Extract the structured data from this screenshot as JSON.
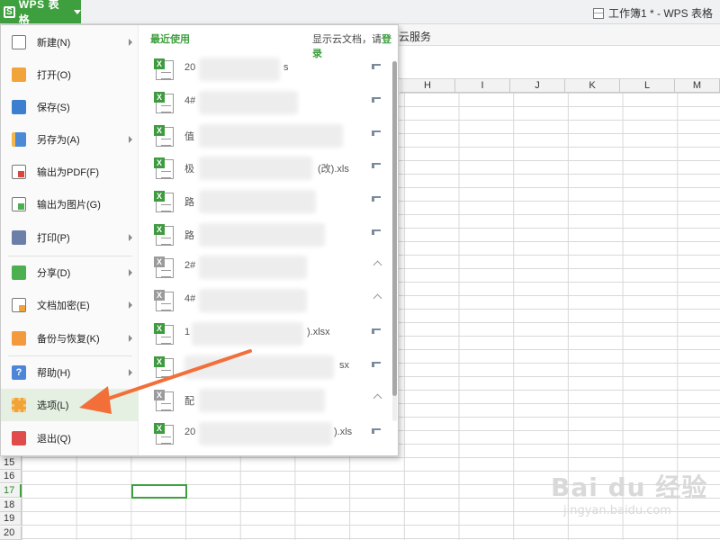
{
  "app": {
    "name": "WPS 表格",
    "logo_letter": "S"
  },
  "window": {
    "title": "工作簿1 * - WPS 表格"
  },
  "ribbon": {
    "visible_tab": "云服务"
  },
  "sheet": {
    "columns": [
      "H",
      "I",
      "J",
      "K",
      "L",
      "M"
    ],
    "rows": [
      "15",
      "16",
      "17",
      "18",
      "19",
      "20"
    ],
    "active_row": "17"
  },
  "file_menu": {
    "items": [
      {
        "label": "新建(N)",
        "icon": "new-file-icon",
        "has_submenu": true
      },
      {
        "label": "打开(O)",
        "icon": "folder-open-icon",
        "has_submenu": false
      },
      {
        "label": "保存(S)",
        "icon": "save-icon",
        "has_submenu": false
      },
      {
        "label": "另存为(A)",
        "icon": "save-as-icon",
        "has_submenu": true
      },
      {
        "label": "输出为PDF(F)",
        "icon": "pdf-icon",
        "has_submenu": false
      },
      {
        "label": "输出为图片(G)",
        "icon": "image-export-icon",
        "has_submenu": false
      },
      {
        "label": "打印(P)",
        "icon": "printer-icon",
        "has_submenu": true
      },
      {
        "label": "分享(D)",
        "icon": "share-icon",
        "has_submenu": true
      },
      {
        "label": "文档加密(E)",
        "icon": "lock-icon",
        "has_submenu": true
      },
      {
        "label": "备份与恢复(K)",
        "icon": "backup-icon",
        "has_submenu": true
      },
      {
        "label": "帮助(H)",
        "icon": "help-icon",
        "has_submenu": true
      },
      {
        "label": "选项(L)",
        "icon": "gear-icon",
        "has_submenu": false
      },
      {
        "label": "退出(Q)",
        "icon": "exit-icon",
        "has_submenu": false
      }
    ]
  },
  "recent": {
    "title": "最近使用",
    "cloud_prompt": "显示云文档，请",
    "cloud_login": "登录",
    "files": [
      {
        "name": "20",
        "suffix": "s",
        "pinned": true,
        "icon": "excel-file-icon"
      },
      {
        "name": "4#",
        "suffix": "",
        "pinned": true,
        "icon": "excel-file-icon"
      },
      {
        "name": "值",
        "suffix": "",
        "pinned": true,
        "icon": "excel-file-icon"
      },
      {
        "name": "极",
        "suffix": "(改).xls",
        "pinned": true,
        "icon": "excel-file-icon"
      },
      {
        "name": "路",
        "suffix": "",
        "pinned": true,
        "icon": "excel-file-icon"
      },
      {
        "name": "路",
        "suffix": "",
        "pinned": true,
        "icon": "excel-file-icon"
      },
      {
        "name": "2#",
        "suffix": "",
        "pinned": false,
        "icon": "excel-file-gray-icon"
      },
      {
        "name": "4#",
        "suffix": "",
        "pinned": false,
        "icon": "excel-file-gray-icon"
      },
      {
        "name": "1",
        "suffix": ").xlsx",
        "pinned": true,
        "icon": "excel-file-icon"
      },
      {
        "name": "",
        "suffix": "sx",
        "pinned": true,
        "icon": "excel-file-icon"
      },
      {
        "name": "配",
        "suffix": "",
        "pinned": false,
        "icon": "excel-file-gray-icon"
      },
      {
        "name": "20",
        "suffix": ").xls",
        "pinned": true,
        "icon": "excel-file-icon"
      }
    ]
  },
  "watermark": {
    "brand": "Bai du 经验",
    "url": "jingyan.baidu.com"
  },
  "colors": {
    "accent": "#3e9f3e",
    "highlight": "#e5f0e2",
    "annotation_arrow": "#f26f3a"
  }
}
